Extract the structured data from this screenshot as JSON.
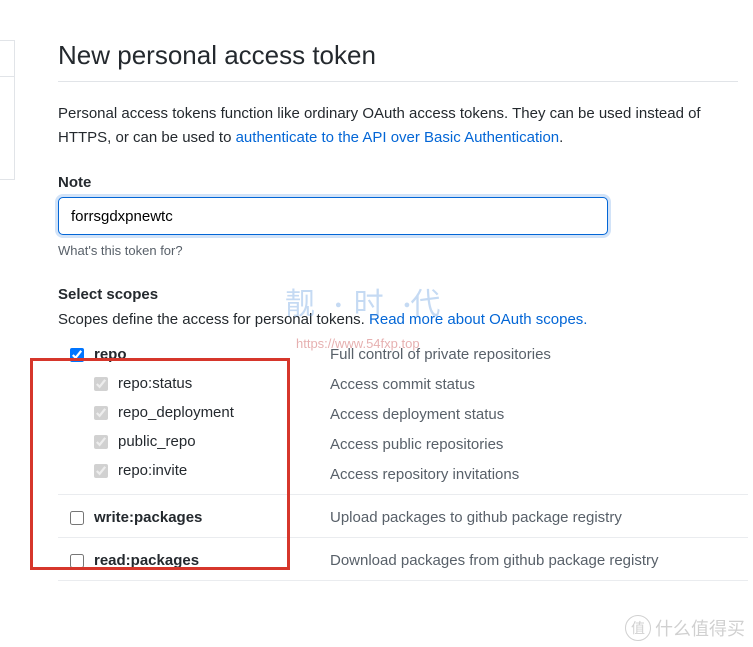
{
  "title": "New personal access token",
  "intro_text_1": "Personal access tokens function like ordinary OAuth access tokens. They can be used instead of HTTPS, or can be used to ",
  "intro_link": "authenticate to the API over Basic Authentication",
  "intro_text_2": ".",
  "note": {
    "label": "Note",
    "value": "forrsgdxpnewtc",
    "help": "What's this token for?"
  },
  "scopes": {
    "heading": "Select scopes",
    "desc_text": "Scopes define the access for personal tokens. ",
    "desc_link": "Read more about OAuth scopes.",
    "groups": [
      {
        "parent": {
          "name": "repo",
          "desc": "Full control of private repositories",
          "checked": true,
          "disabled": false
        },
        "children": [
          {
            "name": "repo:status",
            "desc": "Access commit status",
            "checked": true,
            "disabled": true
          },
          {
            "name": "repo_deployment",
            "desc": "Access deployment status",
            "checked": true,
            "disabled": true
          },
          {
            "name": "public_repo",
            "desc": "Access public repositories",
            "checked": true,
            "disabled": true
          },
          {
            "name": "repo:invite",
            "desc": "Access repository invitations",
            "checked": true,
            "disabled": true
          }
        ]
      },
      {
        "parent": {
          "name": "write:packages",
          "desc": "Upload packages to github package registry",
          "checked": false,
          "disabled": false
        },
        "children": []
      },
      {
        "parent": {
          "name": "read:packages",
          "desc": "Download packages from github package registry",
          "checked": false,
          "disabled": false
        },
        "children": []
      }
    ]
  },
  "watermark": {
    "cn": "靓●时代",
    "url": "https://www.54fxp.top",
    "bottom_circle": "值",
    "bottom_text": "什么值得买"
  }
}
